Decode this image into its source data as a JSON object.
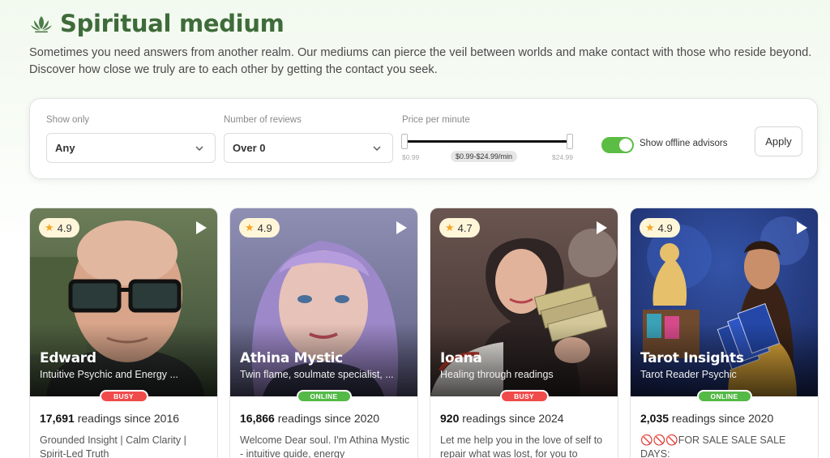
{
  "header": {
    "title": "Spiritual medium",
    "icon": "lotus-icon",
    "description": "Sometimes you need answers from another realm. Our mediums can pierce the veil between worlds and make contact with those who reside beyond. Discover how close we truly are to each other by getting the contact you seek."
  },
  "filters": {
    "show_only_label": "Show only",
    "show_only_value": "Any",
    "reviews_label": "Number of reviews",
    "reviews_value": "Over 0",
    "price_label": "Price per minute",
    "price_min": "$0.99",
    "price_max": "$24.99",
    "price_range": "$0.99-$24.99/min",
    "offline_label": "Show offline advisors",
    "offline_enabled": true,
    "apply_label": "Apply"
  },
  "colors": {
    "brand_green": "#3e6b3a",
    "toggle_green": "#5bbd44",
    "busy_red": "#ef4b4b",
    "online_green": "#54b947",
    "rating_bg": "#fff6d9"
  },
  "advisors": [
    {
      "rating": "4.9",
      "name": "Edward",
      "tagline": "Intuitive Psychic and Energy ...",
      "status": "BUSY",
      "readings_count": "17,691",
      "readings_suffix": " readings since 2016",
      "bio": "Grounded Insight | Calm Clarity | Spirit-Led Truth"
    },
    {
      "rating": "4.9",
      "name": "Athina Mystic",
      "tagline": "Twin flame, soulmate specialist, ...",
      "status": "ONLINE",
      "readings_count": "16,866",
      "readings_suffix": " readings since 2020",
      "bio": "Welcome Dear soul. I'm Athina Mystic - intuitive guide, energy"
    },
    {
      "rating": "4.7",
      "name": "Ioana",
      "tagline": "Healing through readings",
      "status": "BUSY",
      "readings_count": "920",
      "readings_suffix": " readings since 2024",
      "bio": "Let me help you in the love of self to repair what was lost, for you to"
    },
    {
      "rating": "4.9",
      "name": "Tarot Insights",
      "tagline": "Tarot Reader Psychic",
      "status": "ONLINE",
      "readings_count": "2,035",
      "readings_suffix": " readings since 2020",
      "bio": "🚫🚫🚫FOR SALE SALE SALE DAYS:"
    }
  ]
}
